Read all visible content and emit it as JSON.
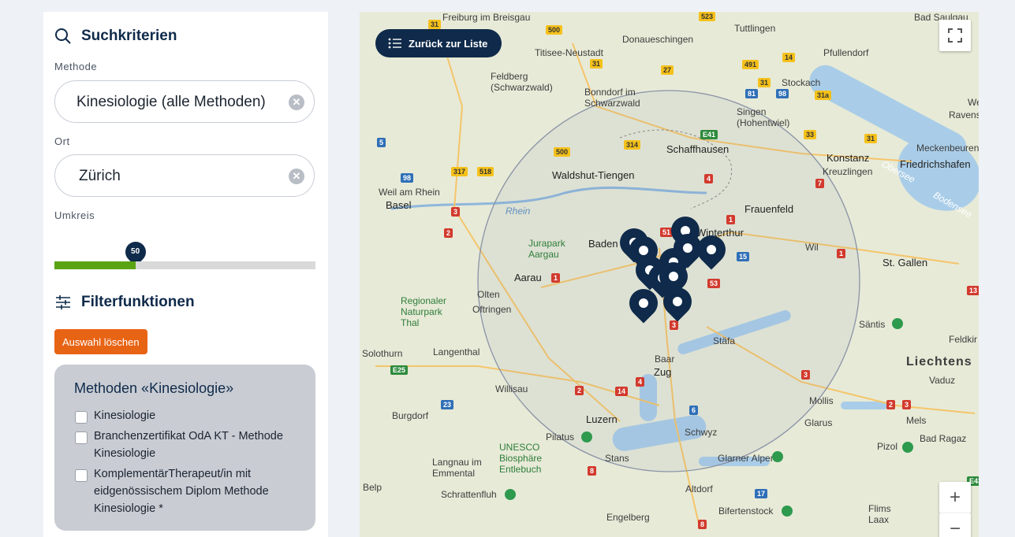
{
  "search": {
    "title": "Suchkriterien",
    "method_label": "Methode",
    "method_value": "Kinesiologie (alle Methoden)",
    "place_label": "Ort",
    "place_value": "Zürich",
    "radius_label": "Umkreis",
    "radius_value": "50",
    "radius_fraction": 0.31
  },
  "filter": {
    "title": "Filterfunktionen",
    "reset_label": "Auswahl löschen",
    "methods_title": "Methoden «Kinesiologie»",
    "options": [
      {
        "label": "Kinesiologie",
        "checked": false
      },
      {
        "label": "Branchenzertifikat OdA KT - Methode Kinesiologie",
        "checked": false
      },
      {
        "label": "KomplementärTherapeut/in mit eidgenössischem Diplom Methode Kinesiologie *",
        "checked": false
      }
    ]
  },
  "map": {
    "back_label": "Zurück zur Liste",
    "zoom_in": "+",
    "zoom_out": "−",
    "cities": [
      "Freiburg im Breisgau",
      "Tuttlingen",
      "Donaueschingen",
      "Titisee-Neustadt",
      "Pfullendorf",
      "Feldberg (Schwarzwald)",
      "Bonndorf im Schwarzwald",
      "Stockach",
      "Singen (Hohentwiel)",
      "Weil am Rhein",
      "Basel",
      "Schaffhausen",
      "Waldshut-Tiengen",
      "Konstanz",
      "Kreuzlingen",
      "Friedrichshafen",
      "Meckenbeuren",
      "Frauenfeld",
      "Winterthur",
      "Baden",
      "Jurapark Aargau",
      "Aarau",
      "Wil",
      "St. Gallen",
      "Regionaler Naturpark Thal",
      "Olten",
      "Oftringen",
      "Säntis",
      "Solothurn",
      "Langenthal",
      "Stäfa",
      "Baar",
      "Zug",
      "Liechtens",
      "Vaduz",
      "Feldkir",
      "Willisau",
      "Burgdorf",
      "Luzern",
      "Mollis",
      "Glarus",
      "Mels",
      "Bad Ragaz",
      "Pilatus",
      "UNESCO Biosphäre Entlebuch",
      "Schwyz",
      "Stans",
      "Glarner Alpen",
      "Pizol",
      "Langnau im Emmental",
      "Schrattenfluh",
      "Altdorf",
      "Belp",
      "Engelberg",
      "Bifertenstock",
      "Flims Laax",
      "Bad Saulgau",
      "Ravens",
      "Wein",
      "Obersee",
      "Bodensee",
      "Rhein"
    ],
    "road_labels": [
      "31",
      "523",
      "500",
      "31",
      "27",
      "491",
      "14",
      "31",
      "81",
      "98",
      "31a",
      "314",
      "E41",
      "33",
      "31",
      "500",
      "317",
      "518",
      "4",
      "7",
      "1",
      "3",
      "2",
      "1",
      "15",
      "53",
      "1",
      "51",
      "3",
      "2",
      "14",
      "4",
      "3",
      "8",
      "6",
      "17",
      "8",
      "2",
      "E25",
      "23",
      "5",
      "98",
      "E43",
      "13",
      "3"
    ],
    "pin_count": 11
  },
  "colors": {
    "navy": "#0f2a4a",
    "orange": "#e86415",
    "green": "#5aa312",
    "panel_gray": "#c9ccd3"
  }
}
